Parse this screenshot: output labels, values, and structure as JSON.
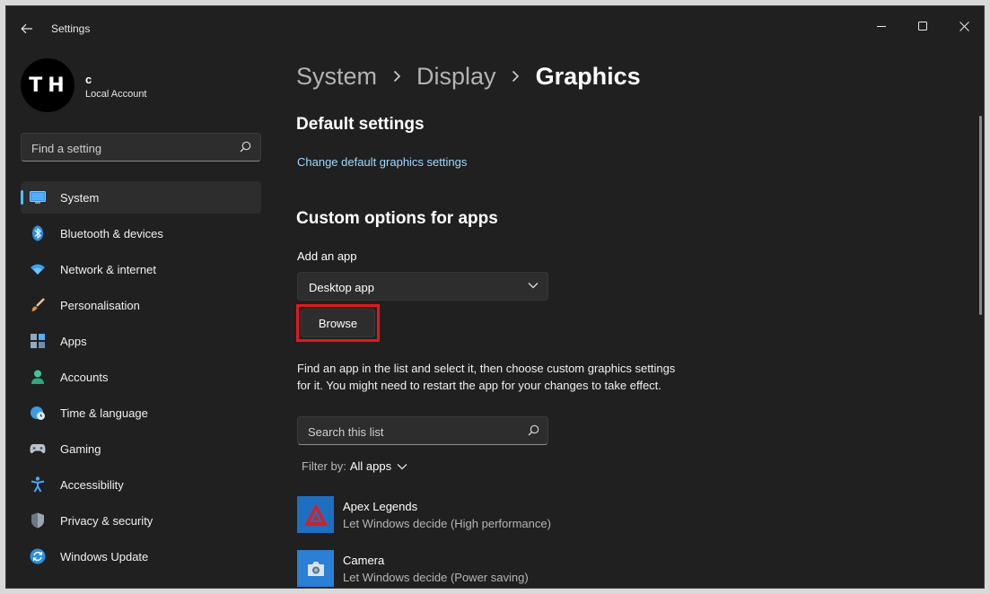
{
  "window": {
    "title": "Settings"
  },
  "user": {
    "avatar_text": "TH",
    "name": "c",
    "account_type": "Local Account"
  },
  "search": {
    "placeholder": "Find a setting"
  },
  "sidebar": {
    "items": [
      {
        "label": "System",
        "icon": "monitor-icon",
        "active": true
      },
      {
        "label": "Bluetooth & devices",
        "icon": "bluetooth-icon"
      },
      {
        "label": "Network & internet",
        "icon": "wifi-icon"
      },
      {
        "label": "Personalisation",
        "icon": "brush-icon"
      },
      {
        "label": "Apps",
        "icon": "apps-icon"
      },
      {
        "label": "Accounts",
        "icon": "person-icon"
      },
      {
        "label": "Time & language",
        "icon": "globe-clock-icon"
      },
      {
        "label": "Gaming",
        "icon": "gamepad-icon"
      },
      {
        "label": "Accessibility",
        "icon": "accessibility-icon"
      },
      {
        "label": "Privacy & security",
        "icon": "shield-icon"
      },
      {
        "label": "Windows Update",
        "icon": "update-icon"
      }
    ]
  },
  "breadcrumb": {
    "items": [
      "System",
      "Display"
    ],
    "current": "Graphics"
  },
  "default_settings": {
    "heading": "Default settings",
    "link": "Change default graphics settings"
  },
  "custom_options": {
    "heading": "Custom options for apps",
    "add_app_label": "Add an app",
    "dropdown_value": "Desktop app",
    "browse_label": "Browse",
    "description": "Find an app in the list and select it, then choose custom graphics settings for it. You might need to restart the app for your changes to take effect.",
    "search_placeholder": "Search this list",
    "filter_label": "Filter by:",
    "filter_value": "All apps"
  },
  "apps": [
    {
      "name": "Apex Legends",
      "preference": "Let Windows decide (High performance)",
      "icon": "apex-legends-icon"
    },
    {
      "name": "Camera",
      "preference": "Let Windows decide (Power saving)",
      "icon": "camera-icon"
    }
  ],
  "colors": {
    "accent": "#4cc2ff",
    "link": "#9ed8ff",
    "highlight": "#e3171f",
    "background": "#202020"
  }
}
